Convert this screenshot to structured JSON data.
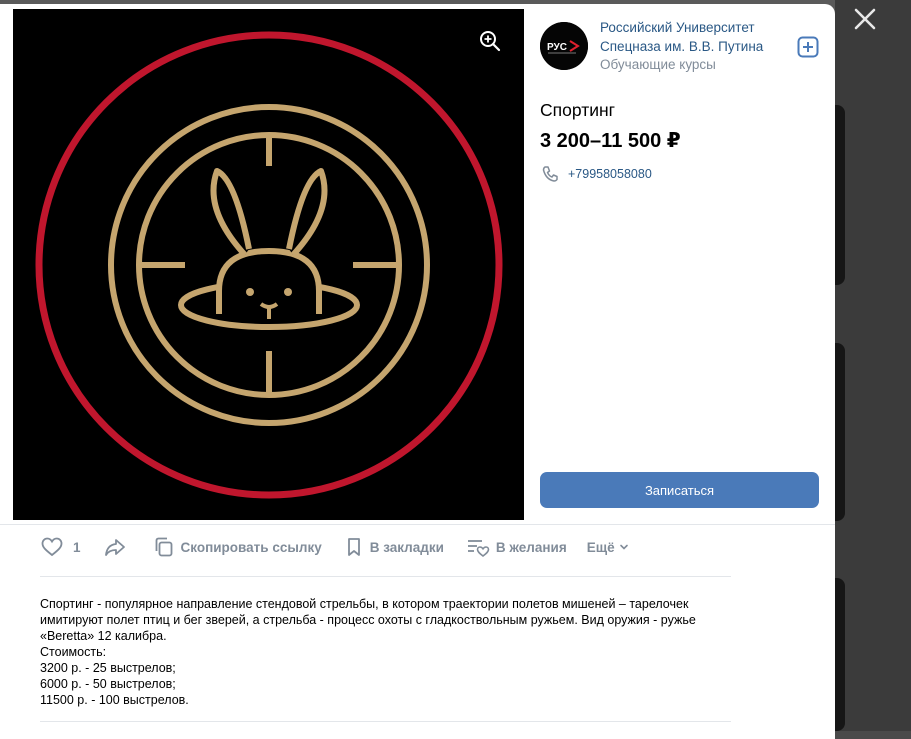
{
  "colors": {
    "accent": "#4a7ab9",
    "link": "#2a5885",
    "muted": "#818c99",
    "logo_red": "#c0162d",
    "logo_gold": "#c5a56e"
  },
  "org": {
    "name": "Российский Университет Спецназа им. В.В. Путина",
    "category": "Обучающие курсы",
    "avatar_text": "РУС"
  },
  "product": {
    "title": "Спортинг",
    "price": "3 200–11 500 ₽",
    "phone": "+79958058080",
    "signup_label": "Записаться"
  },
  "actions": {
    "like_count": "1",
    "copy_link": "Скопировать ссылку",
    "bookmarks": "В закладки",
    "wishes": "В желания",
    "more": "Ещё"
  },
  "description": {
    "lines": [
      "Спортинг - популярное направление стендовой стрельбы, в котором траектории полетов мишеней – тарелочек имитируют полет птиц и бег зверей, а стрельба - процесс охоты с гладкоствольным ружьем. Вид оружия - ружье «Beretta» 12 калибра.",
      "Стоимость:",
      "3200 р. - 25 выстрелов;",
      "6000 р. - 50 выстрелов;",
      "11500 р. - 100 выстрелов."
    ]
  },
  "icons": {
    "close": "close-icon",
    "zoom": "zoom-in-icon",
    "add": "plus-square-icon",
    "phone": "phone-icon",
    "like": "heart-icon",
    "share": "share-arrow-icon",
    "copy": "copy-icon",
    "bookmark": "bookmark-icon",
    "wish": "wishlist-icon",
    "more": "chevron-down-icon"
  }
}
